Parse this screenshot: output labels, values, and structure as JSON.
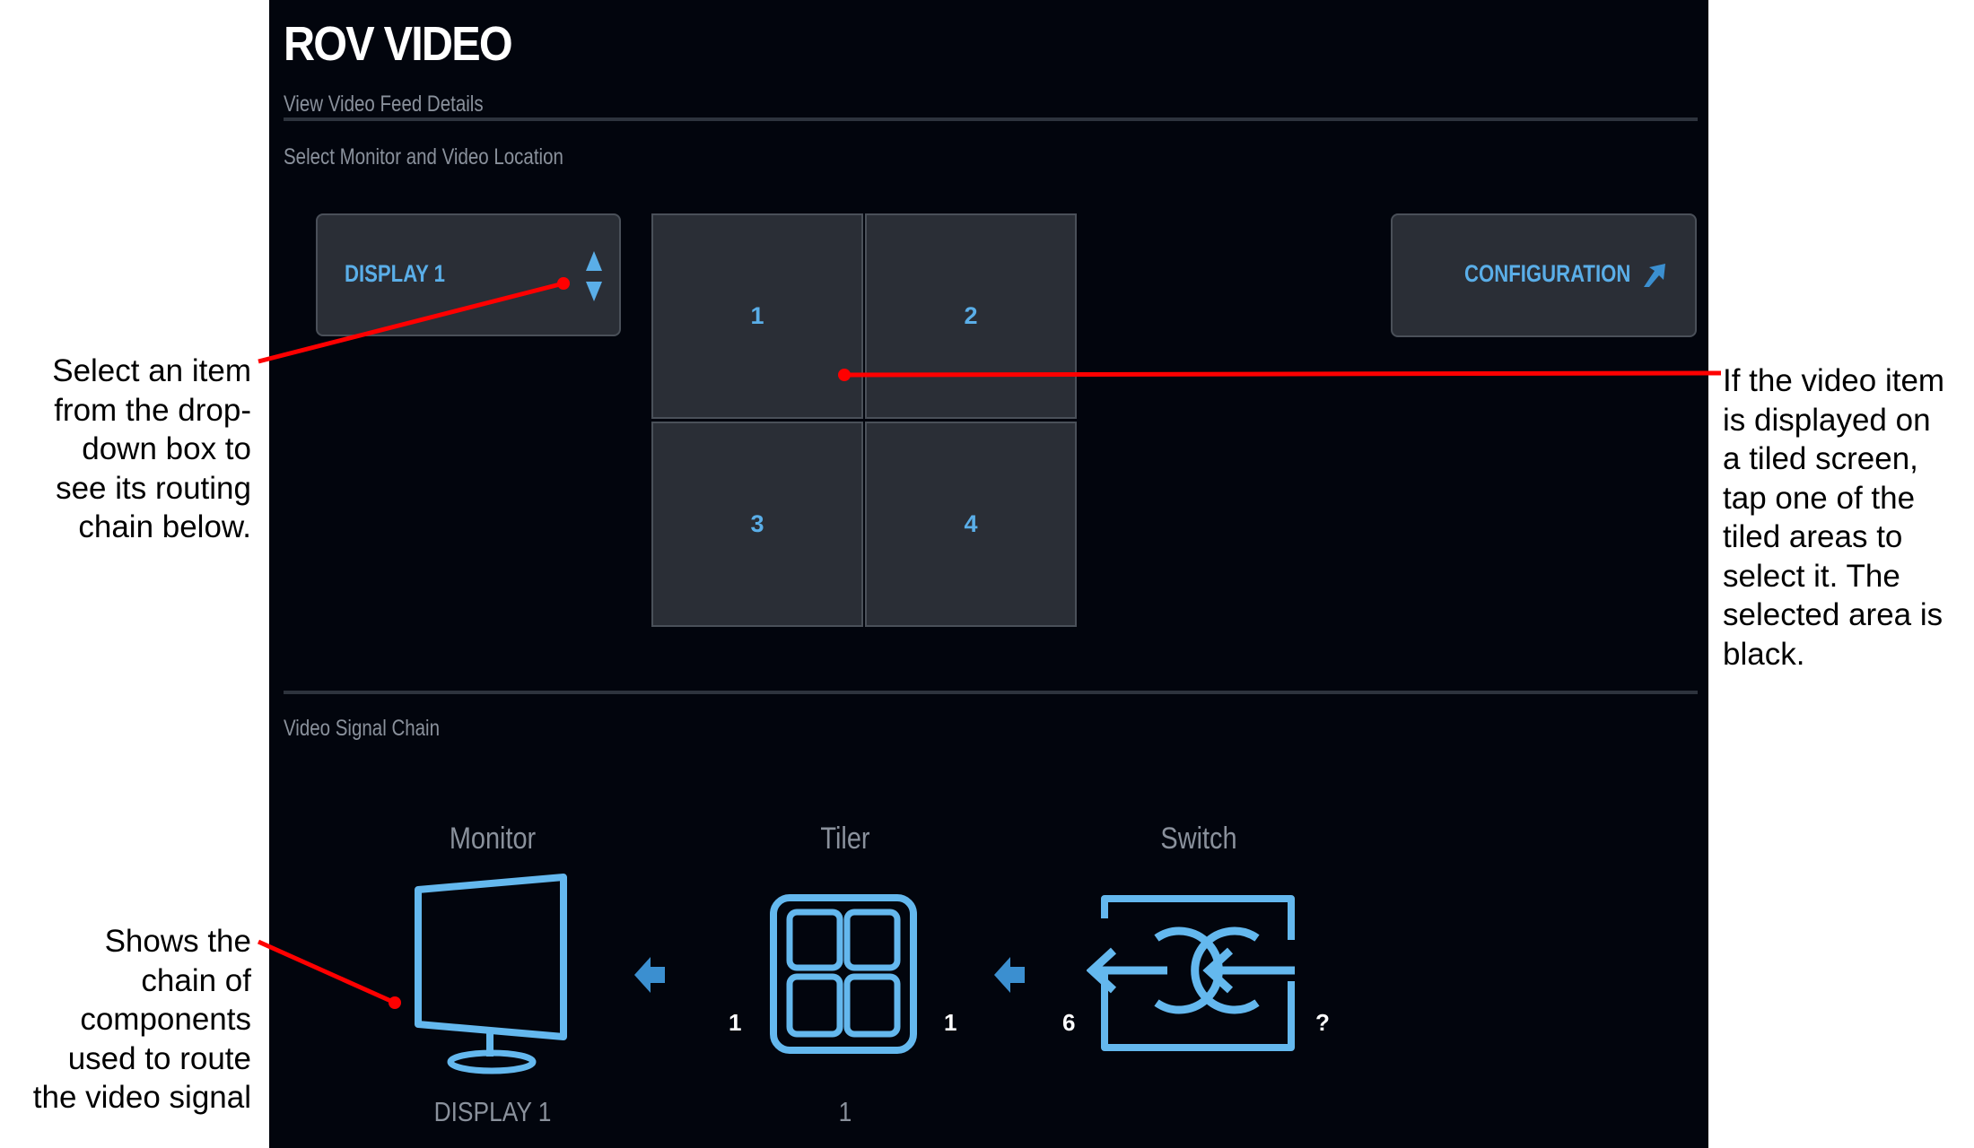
{
  "app": {
    "title": "ROV VIDEO",
    "section_feed": "View Video Feed Details",
    "section_select": "Select Monitor and Video Location",
    "section_chain": "Video Signal Chain"
  },
  "controls": {
    "display_select": {
      "value": "DISPLAY 1",
      "icon": "up-down-arrows-icon"
    },
    "configuration_button": {
      "label": "CONFIGURATION",
      "icon": "external-arrow-icon"
    }
  },
  "tiles": [
    {
      "label": "1",
      "selected": true
    },
    {
      "label": "2",
      "selected": false
    },
    {
      "label": "3",
      "selected": false
    },
    {
      "label": "4",
      "selected": false
    }
  ],
  "chain": {
    "monitor": {
      "label": "Monitor",
      "name": "DISPLAY 1",
      "icon": "monitor-icon"
    },
    "tiler": {
      "label": "Tiler",
      "name": "1",
      "input": "1",
      "output": "1",
      "icon": "tiler-icon"
    },
    "switch": {
      "label": "Switch",
      "input": "6",
      "output": "?",
      "icon": "switch-icon"
    }
  },
  "annotations": {
    "select_item": [
      "Select an item",
      "from the drop-",
      "down box to",
      "see its routing",
      "chain below."
    ],
    "tiled": [
      "If the video item",
      "is displayed on",
      "a tiled screen,",
      "tap one of the",
      "tiled areas to",
      "select it. The",
      "selected area is",
      "black."
    ],
    "chain": [
      "Shows the",
      "chain of",
      "components",
      "used to route",
      "the video signal"
    ]
  },
  "colors": {
    "background": "#02050d",
    "panel": "#2a2e36",
    "accent": "#5aaee8",
    "annotation_line": "#ff0000"
  }
}
